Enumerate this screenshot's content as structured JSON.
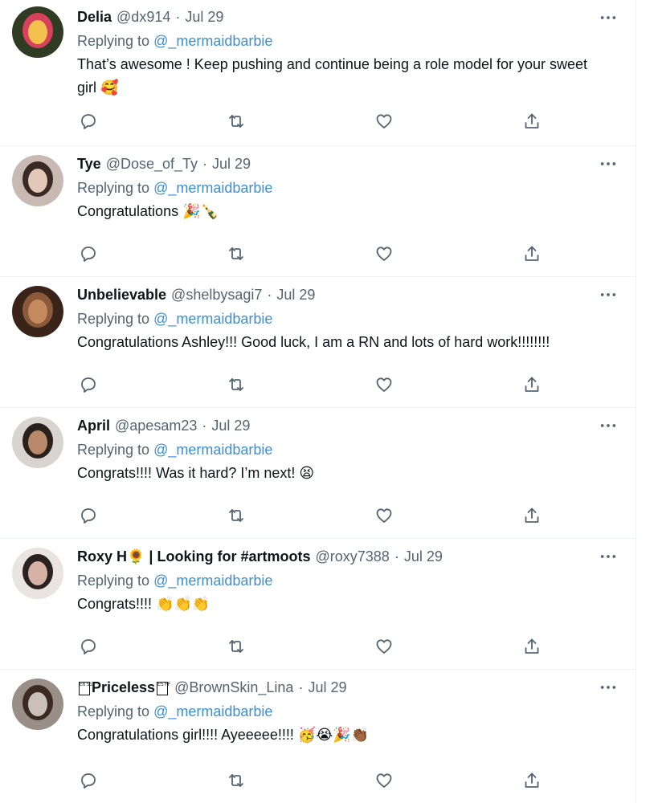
{
  "replying_to_label": "Replying to",
  "tweets": [
    {
      "name": "Delia",
      "handle": "@dx914",
      "date": "Jul 29",
      "mention": "@_mermaidbarbie",
      "text": "That’s awesome ! Keep pushing and continue being a role model for your sweet girl 🥰",
      "avatar_colors": [
        "#2f3b22",
        "#d8415b",
        "#f2c14e"
      ]
    },
    {
      "name": "Tye",
      "handle": "@Dose_of_Ty",
      "date": "Jul 29",
      "mention": "@_mermaidbarbie",
      "text": "Congratulations 🎉🍾",
      "avatar_colors": [
        "#c9b9b3",
        "#3a2a25",
        "#e3c7b8"
      ]
    },
    {
      "name": "Unbelievable",
      "handle": "@shelbysagi7",
      "date": "Jul 29",
      "mention": "@_mermaidbarbie",
      "text": "Congratulations Ashley!!! Good luck, I am a RN and lots of hard work!!!!!!!!",
      "avatar_colors": [
        "#3a2419",
        "#8a5a3b",
        "#c48a5d"
      ]
    },
    {
      "name": "April",
      "handle": "@apesam23",
      "date": "Jul 29",
      "mention": "@_mermaidbarbie",
      "text": "Congrats!!!! Was it hard? I’m next! 😫",
      "avatar_colors": [
        "#d8d4cf",
        "#2a211d",
        "#b88a6b"
      ]
    },
    {
      "name": "Roxy H🌻 | Looking for #artmoots",
      "handle": "@roxy7388",
      "date": "Jul 29",
      "mention": "@_mermaidbarbie",
      "text": "Congrats!!!! 👏👏👏",
      "avatar_colors": [
        "#e9e4e2",
        "#2b2220",
        "#d6b1a5"
      ]
    },
    {
      "name": "Priceless",
      "name_prefix_glyph": "E6 51",
      "name_suffix_glyph": "E5 FF",
      "handle": "@BrownSkin_Lina",
      "date": "Jul 29",
      "mention": "@_mermaidbarbie",
      "text": "Congratulations girl!!!! Ayeeeee!!!! 🥳😭🎉👏🏾",
      "avatar_colors": [
        "#9a8f86",
        "#3b2a22",
        "#c9c0b8"
      ]
    }
  ],
  "icons": {
    "more": "more-horizontal-icon",
    "reply": "reply-icon",
    "retweet": "retweet-icon",
    "like": "like-icon",
    "share": "share-icon"
  },
  "colors": {
    "accent": "#3a8fd6",
    "muted": "#536471",
    "text": "#0f1419",
    "divider": "#eff3f4"
  }
}
